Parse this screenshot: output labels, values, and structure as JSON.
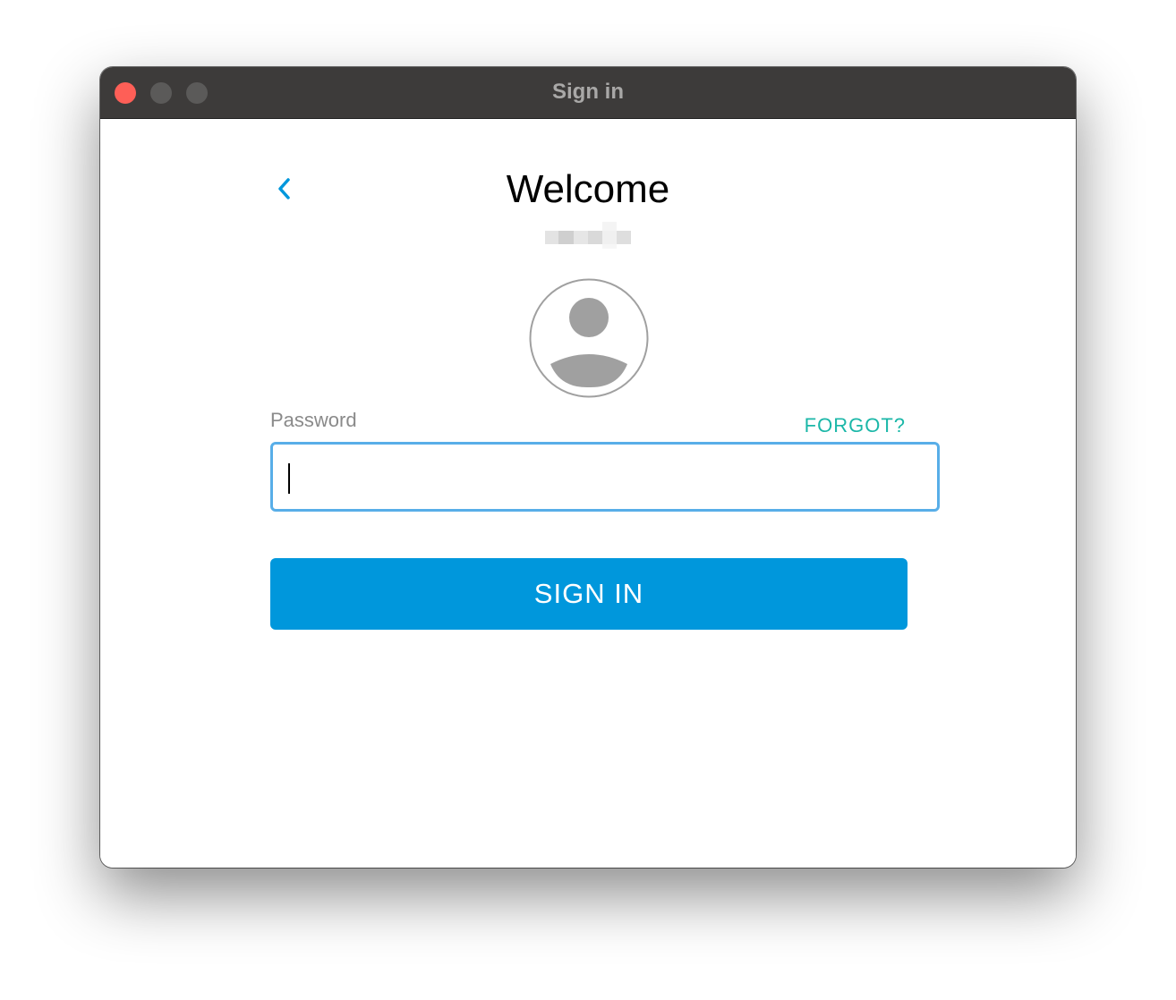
{
  "window": {
    "title": "Sign in",
    "controls": [
      "close",
      "minimize",
      "maximize"
    ]
  },
  "header": {
    "back_icon": "chevron-left-icon",
    "heading": "Welcome"
  },
  "avatar": {
    "icon": "user-avatar-icon"
  },
  "form": {
    "password_label": "Password",
    "forgot_link": "FORGOT?",
    "password_value": "",
    "submit_label": "SIGN IN"
  },
  "colors": {
    "accent": "#0097dc",
    "link": "#1bb7a8",
    "focus_border": "#58aee8",
    "titlebar": "#3d3b3a",
    "close_button": "#fe5f57"
  }
}
